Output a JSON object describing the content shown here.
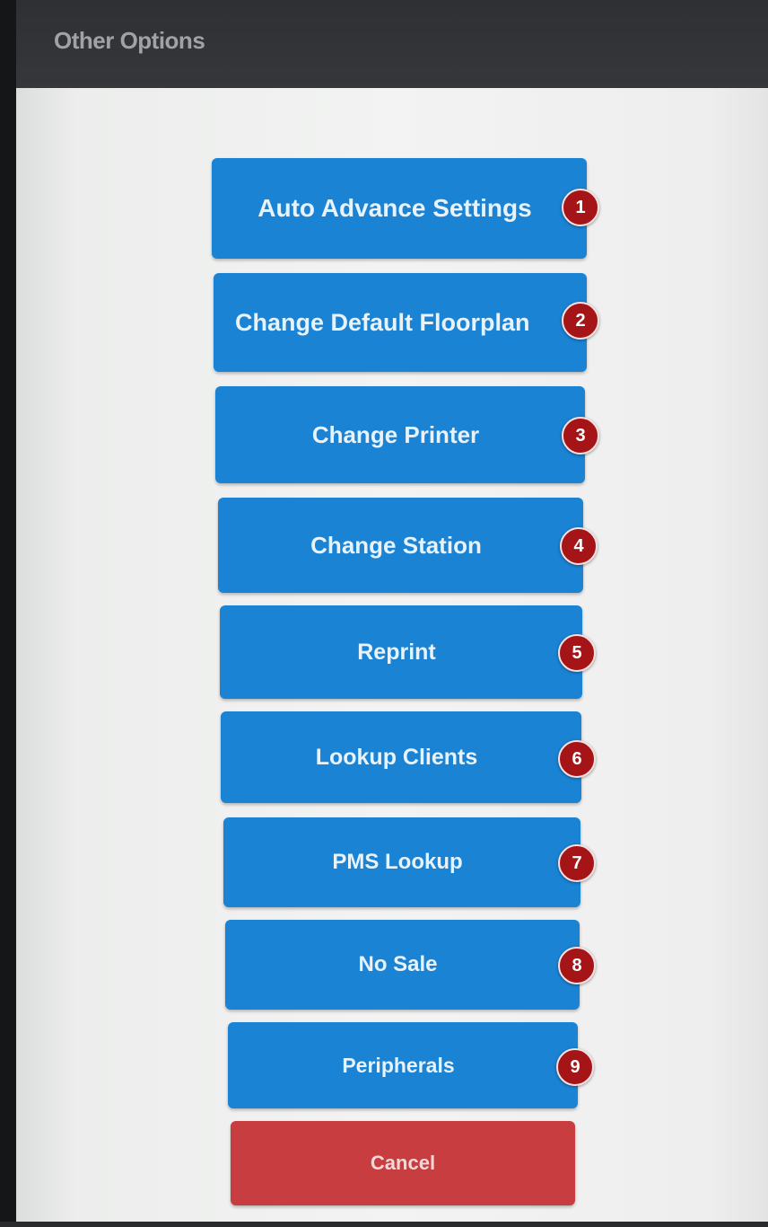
{
  "header": {
    "title": "Other Options"
  },
  "options": [
    {
      "label": "Auto Advance Settings",
      "badge": "1"
    },
    {
      "label": "Change Default Floorplan",
      "badge": "2"
    },
    {
      "label": "Change Printer",
      "badge": "3"
    },
    {
      "label": "Change Station",
      "badge": "4"
    },
    {
      "label": "Reprint",
      "badge": "5"
    },
    {
      "label": "Lookup Clients",
      "badge": "6"
    },
    {
      "label": "PMS Lookup",
      "badge": "7"
    },
    {
      "label": "No Sale",
      "badge": "8"
    },
    {
      "label": "Peripherals",
      "badge": "9"
    }
  ],
  "cancel": {
    "label": "Cancel"
  },
  "colors": {
    "button_blue": "#1a83d4",
    "cancel_red": "#c83d3f",
    "badge_red": "#a51416",
    "header_dark": "#2e3033"
  }
}
